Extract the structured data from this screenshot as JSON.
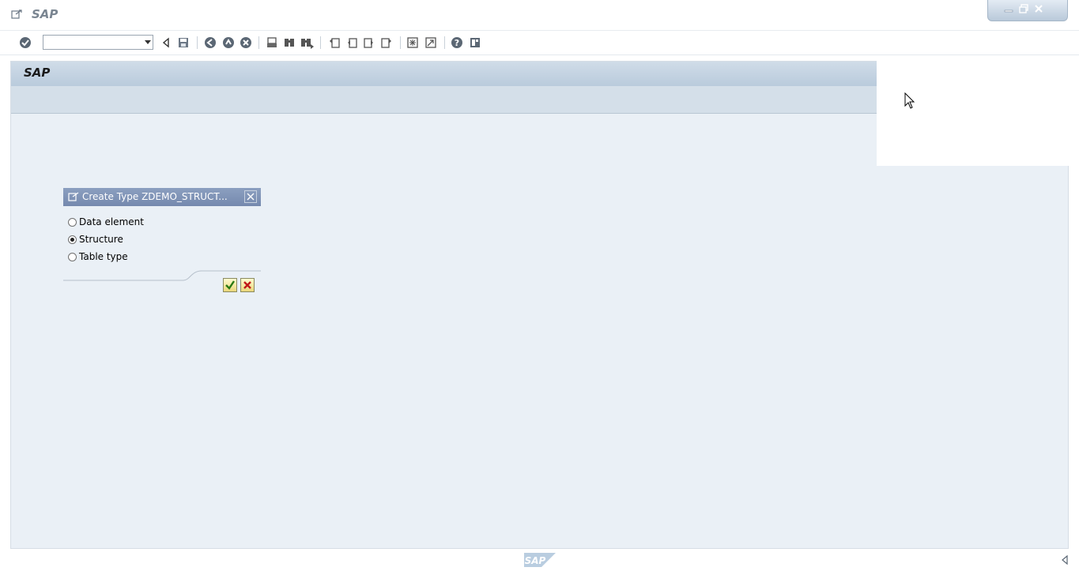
{
  "window": {
    "title": "SAP",
    "controls": [
      "minimize-icon",
      "restore-icon",
      "close-icon"
    ]
  },
  "toolbar": {
    "command_field_value": "",
    "icons": [
      "enter-icon",
      "back-arrow-icon",
      "save-icon",
      "back-icon",
      "exit-icon",
      "cancel-icon",
      "print-icon",
      "find-icon",
      "find-next-icon",
      "first-page-icon",
      "previous-page-icon",
      "next-page-icon",
      "last-page-icon",
      "create-session-icon",
      "shortcut-icon",
      "help-icon",
      "layout-icon"
    ]
  },
  "screen": {
    "title": "SAP"
  },
  "dialog": {
    "title": "Create Type ZDEMO_STRUCT...",
    "options": [
      {
        "label": "Data element",
        "selected": false
      },
      {
        "label": "Structure",
        "selected": true
      },
      {
        "label": "Table type",
        "selected": false
      }
    ],
    "buttons": [
      "confirm-icon",
      "cancel-icon"
    ]
  },
  "footer": {
    "logo_text": "SAP"
  },
  "colors": {
    "screen_background": "#eaf0f6",
    "header_band": "#c3d3e2",
    "dialog_title_bar": "#7f93b7"
  }
}
